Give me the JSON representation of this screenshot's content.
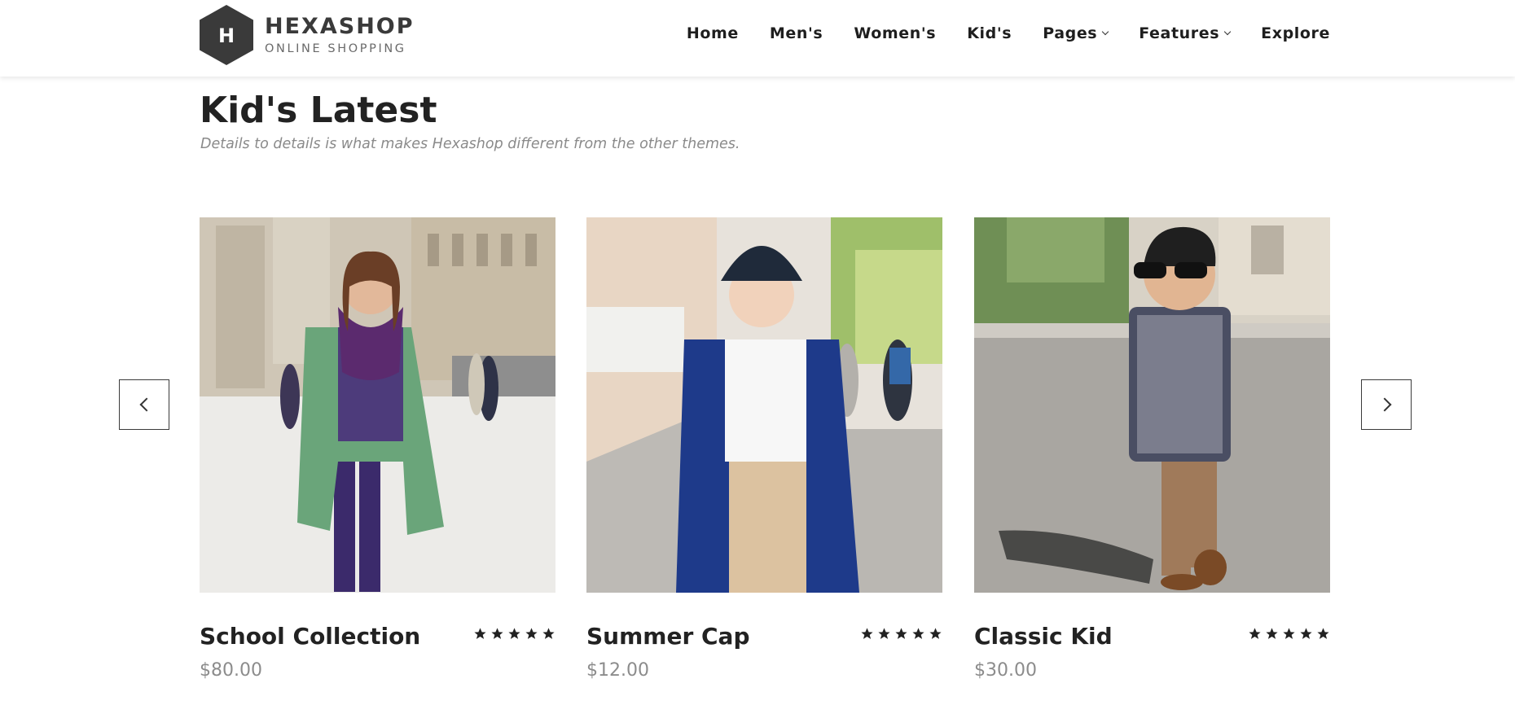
{
  "brand": {
    "letter": "H",
    "name": "HEXASHOP",
    "tagline": "ONLINE SHOPPING"
  },
  "nav": {
    "items": [
      {
        "label": "Home"
      },
      {
        "label": "Men's"
      },
      {
        "label": "Women's"
      },
      {
        "label": "Kid's"
      },
      {
        "label": "Pages"
      },
      {
        "label": "Features"
      },
      {
        "label": "Explore"
      }
    ]
  },
  "section": {
    "title": "Kid's Latest",
    "subtitle": "Details to details is what makes Hexashop different from the other themes."
  },
  "products": [
    {
      "name": "School Collection",
      "price": "$80.00",
      "rating": 5
    },
    {
      "name": "Summer Cap",
      "price": "$12.00",
      "rating": 5
    },
    {
      "name": "Classic Kid",
      "price": "$30.00",
      "rating": 5
    }
  ],
  "carousel": {
    "prev_icon": "chevron-left-icon",
    "next_icon": "chevron-right-icon"
  },
  "colors": {
    "text": "#222222",
    "muted": "#8c8c8c",
    "logo": "#3a3a3a"
  }
}
